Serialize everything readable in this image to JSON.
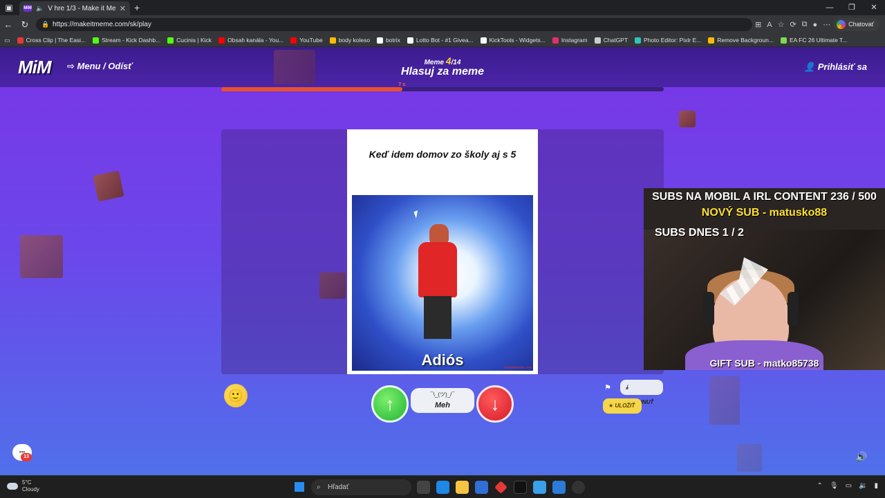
{
  "browser": {
    "tab_title": "V hre 1/3 - Make it Meme",
    "tab_favicon": "MiM",
    "url": "https://makeitmeme.com/sk/play",
    "chat_label": "Chatovať",
    "bookmarks": [
      {
        "label": "Cross Clip | The Easi...",
        "color": "#e53935"
      },
      {
        "label": "Stream - Kick Dashb...",
        "color": "#53fc18"
      },
      {
        "label": "Cucinis | Kick",
        "color": "#53fc18"
      },
      {
        "label": "Obsah kanála - You...",
        "color": "#ff0000"
      },
      {
        "label": "YouTube",
        "color": "#ff0000"
      },
      {
        "label": "body koleso",
        "color": "#fbbc04"
      },
      {
        "label": "botrix",
        "color": "#ffffff"
      },
      {
        "label": "Lotto Bot - #1 Givea...",
        "color": "#ffffff"
      },
      {
        "label": "KickTools - Widgets...",
        "color": "#ffffff"
      },
      {
        "label": "Instagram",
        "color": "#e1306c"
      },
      {
        "label": "ChatGPT",
        "color": "#cccccc"
      },
      {
        "label": "Photo Editor: Pixlr E...",
        "color": "#2ec4b6"
      },
      {
        "label": "Remove Backgroun...",
        "color": "#fbbc04"
      },
      {
        "label": "EA FC 26 Ultimate T...",
        "color": "#7ed957"
      }
    ]
  },
  "game": {
    "logo": "MiM",
    "menu_label": "Menu / Odísť",
    "login_label": "Prihlásiť sa",
    "meme_prefix": "Meme",
    "meme_current": "4",
    "meme_total": "/14",
    "heading": "Hlasuj za meme",
    "timer": "7 s",
    "progress_fraction": 0.41
  },
  "meme": {
    "caption": "Keď idem domov zo školy aj s 5",
    "image_text": "Adiós",
    "watermark": "makeitmeme.com"
  },
  "stream_overlay": {
    "line1": "SUBS NA MOBIL A IRL CONTENT  236 / 500",
    "line2": "NOVÝ SUB - matusko88",
    "line3": "SUBS DNES  1 / 2",
    "gift": "GIFT SUB - matko85738"
  },
  "controls": {
    "up_icon": "arrow-up-icon",
    "meh_shrug": "¯\\_(ツ)_/¯",
    "meh_label": "Meh",
    "down_icon": "arrow-down-icon",
    "download_label": "STIAHNUŤ",
    "save_label": "ULOŽIŤ",
    "chat_badge": "13"
  },
  "taskbar": {
    "temperature": "5°C",
    "weather": "Cloudy",
    "search_placeholder": "Hľadať"
  }
}
